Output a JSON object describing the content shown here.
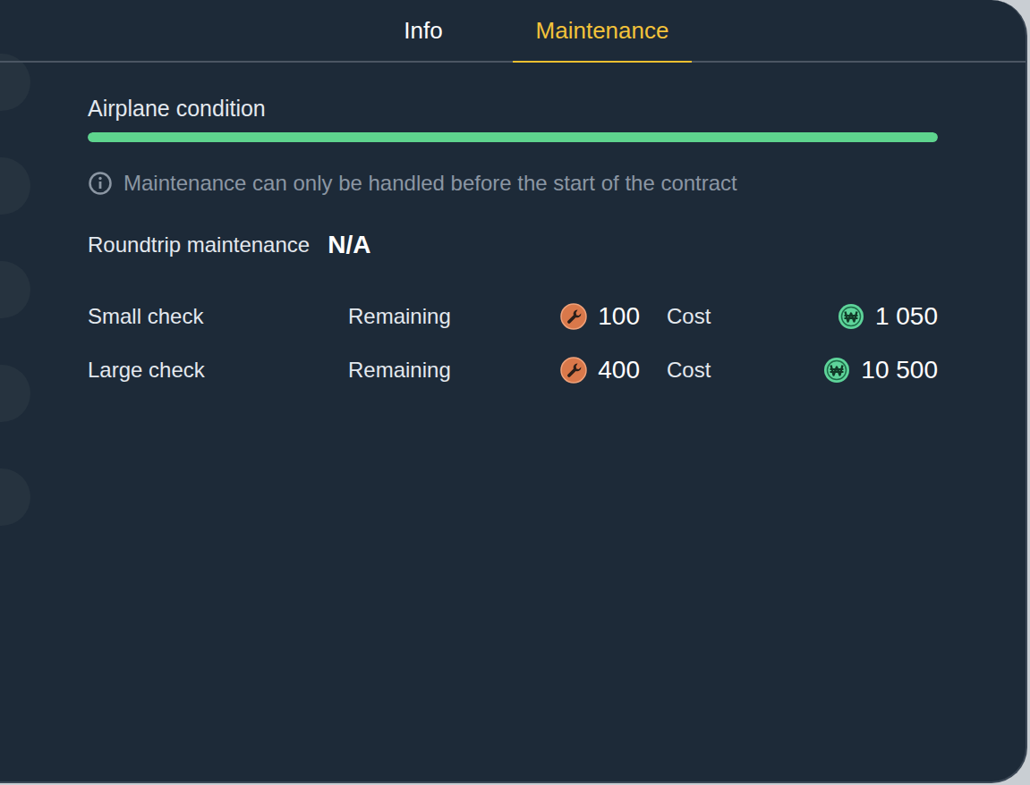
{
  "tabs": [
    {
      "label": "Info",
      "selected": false
    },
    {
      "label": "Maintenance",
      "selected": true
    }
  ],
  "condition": {
    "label": "Airplane condition",
    "level": 1.0
  },
  "notice": {
    "text": "Maintenance can only be handled before the start of the contract"
  },
  "roundtrip": {
    "label": "Roundtrip maintenance",
    "value": "N/A"
  },
  "checks": [
    {
      "name": "Small check",
      "remaining_label": "Remaining",
      "remaining": "100",
      "cost_label": "Cost",
      "cost": "1 050"
    },
    {
      "name": "Large check",
      "remaining_label": "Remaining",
      "remaining": "400",
      "cost_label": "Cost",
      "cost": "10 500"
    }
  ]
}
